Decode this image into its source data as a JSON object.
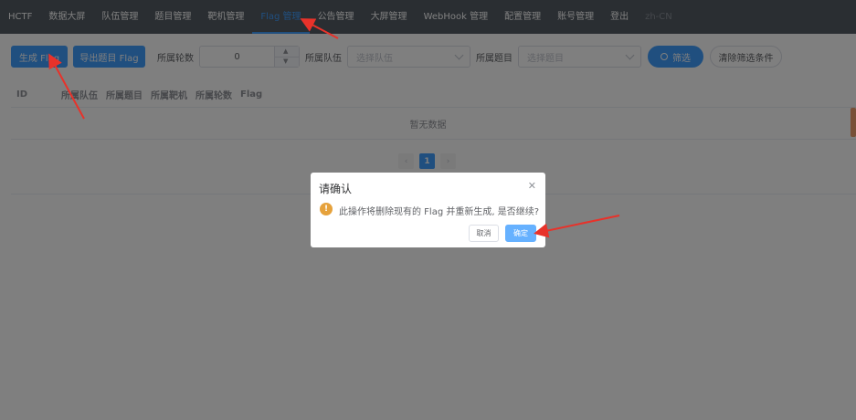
{
  "nav": {
    "items": [
      "HCTF",
      "数据大屏",
      "队伍管理",
      "题目管理",
      "靶机管理",
      "Flag 管理",
      "公告管理",
      "大屏管理",
      "WebHook 管理",
      "配置管理",
      "账号管理",
      "登出",
      "zh-CN"
    ],
    "active_index": 5
  },
  "toolbar": {
    "generate_label": "生成 Flag",
    "export_label": "导出题目 Flag",
    "round_label": "所属轮数",
    "round_value": "0",
    "team_label": "所属队伍",
    "team_placeholder": "选择队伍",
    "challenge_label": "所属题目",
    "challenge_placeholder": "选择题目",
    "filter_label": "筛选",
    "clear_label": "清除筛选条件"
  },
  "table": {
    "columns": [
      "ID",
      "所属队伍",
      "所属题目",
      "所属靶机",
      "所属轮数",
      "Flag"
    ],
    "empty_text": "暂无数据"
  },
  "pagination": {
    "current": "1"
  },
  "dialog": {
    "title": "请确认",
    "message": "此操作将删除现有的 Flag 并重新生成, 是否继续?",
    "cancel_label": "取消",
    "confirm_label": "确定"
  },
  "colors": {
    "primary": "#409eff",
    "nav_bg": "#545c64",
    "warning": "#e6a23c",
    "annotation": "#e8322a"
  }
}
